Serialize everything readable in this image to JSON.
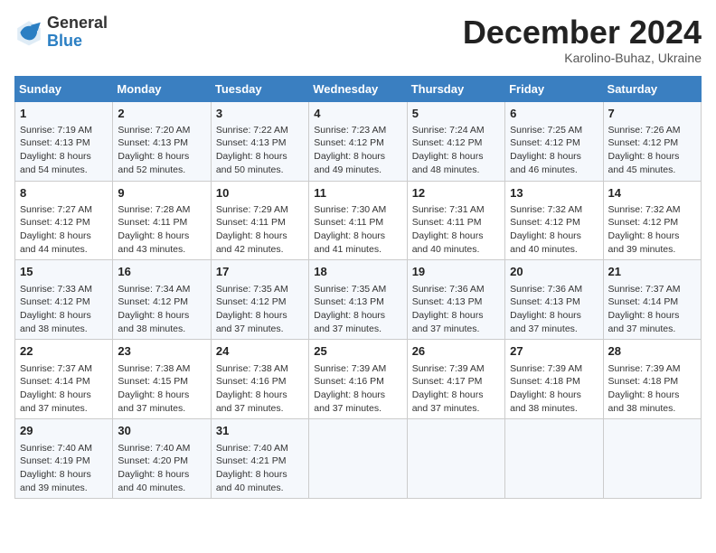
{
  "header": {
    "logo_general": "General",
    "logo_blue": "Blue",
    "month_title": "December 2024",
    "subtitle": "Karolino-Buhaz, Ukraine"
  },
  "weekdays": [
    "Sunday",
    "Monday",
    "Tuesday",
    "Wednesday",
    "Thursday",
    "Friday",
    "Saturday"
  ],
  "weeks": [
    [
      {
        "day": "1",
        "sunrise": "Sunrise: 7:19 AM",
        "sunset": "Sunset: 4:13 PM",
        "daylight": "Daylight: 8 hours and 54 minutes."
      },
      {
        "day": "2",
        "sunrise": "Sunrise: 7:20 AM",
        "sunset": "Sunset: 4:13 PM",
        "daylight": "Daylight: 8 hours and 52 minutes."
      },
      {
        "day": "3",
        "sunrise": "Sunrise: 7:22 AM",
        "sunset": "Sunset: 4:13 PM",
        "daylight": "Daylight: 8 hours and 50 minutes."
      },
      {
        "day": "4",
        "sunrise": "Sunrise: 7:23 AM",
        "sunset": "Sunset: 4:12 PM",
        "daylight": "Daylight: 8 hours and 49 minutes."
      },
      {
        "day": "5",
        "sunrise": "Sunrise: 7:24 AM",
        "sunset": "Sunset: 4:12 PM",
        "daylight": "Daylight: 8 hours and 48 minutes."
      },
      {
        "day": "6",
        "sunrise": "Sunrise: 7:25 AM",
        "sunset": "Sunset: 4:12 PM",
        "daylight": "Daylight: 8 hours and 46 minutes."
      },
      {
        "day": "7",
        "sunrise": "Sunrise: 7:26 AM",
        "sunset": "Sunset: 4:12 PM",
        "daylight": "Daylight: 8 hours and 45 minutes."
      }
    ],
    [
      {
        "day": "8",
        "sunrise": "Sunrise: 7:27 AM",
        "sunset": "Sunset: 4:12 PM",
        "daylight": "Daylight: 8 hours and 44 minutes."
      },
      {
        "day": "9",
        "sunrise": "Sunrise: 7:28 AM",
        "sunset": "Sunset: 4:11 PM",
        "daylight": "Daylight: 8 hours and 43 minutes."
      },
      {
        "day": "10",
        "sunrise": "Sunrise: 7:29 AM",
        "sunset": "Sunset: 4:11 PM",
        "daylight": "Daylight: 8 hours and 42 minutes."
      },
      {
        "day": "11",
        "sunrise": "Sunrise: 7:30 AM",
        "sunset": "Sunset: 4:11 PM",
        "daylight": "Daylight: 8 hours and 41 minutes."
      },
      {
        "day": "12",
        "sunrise": "Sunrise: 7:31 AM",
        "sunset": "Sunset: 4:11 PM",
        "daylight": "Daylight: 8 hours and 40 minutes."
      },
      {
        "day": "13",
        "sunrise": "Sunrise: 7:32 AM",
        "sunset": "Sunset: 4:12 PM",
        "daylight": "Daylight: 8 hours and 40 minutes."
      },
      {
        "day": "14",
        "sunrise": "Sunrise: 7:32 AM",
        "sunset": "Sunset: 4:12 PM",
        "daylight": "Daylight: 8 hours and 39 minutes."
      }
    ],
    [
      {
        "day": "15",
        "sunrise": "Sunrise: 7:33 AM",
        "sunset": "Sunset: 4:12 PM",
        "daylight": "Daylight: 8 hours and 38 minutes."
      },
      {
        "day": "16",
        "sunrise": "Sunrise: 7:34 AM",
        "sunset": "Sunset: 4:12 PM",
        "daylight": "Daylight: 8 hours and 38 minutes."
      },
      {
        "day": "17",
        "sunrise": "Sunrise: 7:35 AM",
        "sunset": "Sunset: 4:12 PM",
        "daylight": "Daylight: 8 hours and 37 minutes."
      },
      {
        "day": "18",
        "sunrise": "Sunrise: 7:35 AM",
        "sunset": "Sunset: 4:13 PM",
        "daylight": "Daylight: 8 hours and 37 minutes."
      },
      {
        "day": "19",
        "sunrise": "Sunrise: 7:36 AM",
        "sunset": "Sunset: 4:13 PM",
        "daylight": "Daylight: 8 hours and 37 minutes."
      },
      {
        "day": "20",
        "sunrise": "Sunrise: 7:36 AM",
        "sunset": "Sunset: 4:13 PM",
        "daylight": "Daylight: 8 hours and 37 minutes."
      },
      {
        "day": "21",
        "sunrise": "Sunrise: 7:37 AM",
        "sunset": "Sunset: 4:14 PM",
        "daylight": "Daylight: 8 hours and 37 minutes."
      }
    ],
    [
      {
        "day": "22",
        "sunrise": "Sunrise: 7:37 AM",
        "sunset": "Sunset: 4:14 PM",
        "daylight": "Daylight: 8 hours and 37 minutes."
      },
      {
        "day": "23",
        "sunrise": "Sunrise: 7:38 AM",
        "sunset": "Sunset: 4:15 PM",
        "daylight": "Daylight: 8 hours and 37 minutes."
      },
      {
        "day": "24",
        "sunrise": "Sunrise: 7:38 AM",
        "sunset": "Sunset: 4:16 PM",
        "daylight": "Daylight: 8 hours and 37 minutes."
      },
      {
        "day": "25",
        "sunrise": "Sunrise: 7:39 AM",
        "sunset": "Sunset: 4:16 PM",
        "daylight": "Daylight: 8 hours and 37 minutes."
      },
      {
        "day": "26",
        "sunrise": "Sunrise: 7:39 AM",
        "sunset": "Sunset: 4:17 PM",
        "daylight": "Daylight: 8 hours and 37 minutes."
      },
      {
        "day": "27",
        "sunrise": "Sunrise: 7:39 AM",
        "sunset": "Sunset: 4:18 PM",
        "daylight": "Daylight: 8 hours and 38 minutes."
      },
      {
        "day": "28",
        "sunrise": "Sunrise: 7:39 AM",
        "sunset": "Sunset: 4:18 PM",
        "daylight": "Daylight: 8 hours and 38 minutes."
      }
    ],
    [
      {
        "day": "29",
        "sunrise": "Sunrise: 7:40 AM",
        "sunset": "Sunset: 4:19 PM",
        "daylight": "Daylight: 8 hours and 39 minutes."
      },
      {
        "day": "30",
        "sunrise": "Sunrise: 7:40 AM",
        "sunset": "Sunset: 4:20 PM",
        "daylight": "Daylight: 8 hours and 40 minutes."
      },
      {
        "day": "31",
        "sunrise": "Sunrise: 7:40 AM",
        "sunset": "Sunset: 4:21 PM",
        "daylight": "Daylight: 8 hours and 40 minutes."
      },
      null,
      null,
      null,
      null
    ]
  ]
}
